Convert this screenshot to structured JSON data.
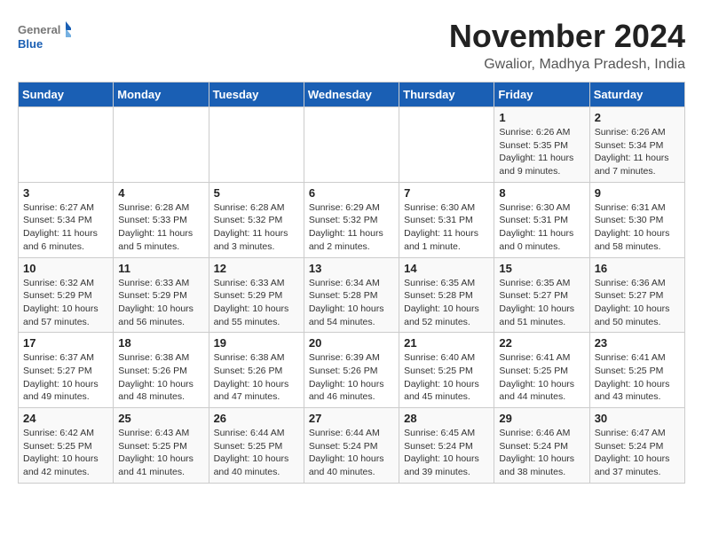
{
  "logo": {
    "general": "General",
    "blue": "Blue"
  },
  "title": "November 2024",
  "location": "Gwalior, Madhya Pradesh, India",
  "weekdays": [
    "Sunday",
    "Monday",
    "Tuesday",
    "Wednesday",
    "Thursday",
    "Friday",
    "Saturday"
  ],
  "weeks": [
    [
      {
        "day": "",
        "info": ""
      },
      {
        "day": "",
        "info": ""
      },
      {
        "day": "",
        "info": ""
      },
      {
        "day": "",
        "info": ""
      },
      {
        "day": "",
        "info": ""
      },
      {
        "day": "1",
        "info": "Sunrise: 6:26 AM\nSunset: 5:35 PM\nDaylight: 11 hours and 9 minutes."
      },
      {
        "day": "2",
        "info": "Sunrise: 6:26 AM\nSunset: 5:34 PM\nDaylight: 11 hours and 7 minutes."
      }
    ],
    [
      {
        "day": "3",
        "info": "Sunrise: 6:27 AM\nSunset: 5:34 PM\nDaylight: 11 hours and 6 minutes."
      },
      {
        "day": "4",
        "info": "Sunrise: 6:28 AM\nSunset: 5:33 PM\nDaylight: 11 hours and 5 minutes."
      },
      {
        "day": "5",
        "info": "Sunrise: 6:28 AM\nSunset: 5:32 PM\nDaylight: 11 hours and 3 minutes."
      },
      {
        "day": "6",
        "info": "Sunrise: 6:29 AM\nSunset: 5:32 PM\nDaylight: 11 hours and 2 minutes."
      },
      {
        "day": "7",
        "info": "Sunrise: 6:30 AM\nSunset: 5:31 PM\nDaylight: 11 hours and 1 minute."
      },
      {
        "day": "8",
        "info": "Sunrise: 6:30 AM\nSunset: 5:31 PM\nDaylight: 11 hours and 0 minutes."
      },
      {
        "day": "9",
        "info": "Sunrise: 6:31 AM\nSunset: 5:30 PM\nDaylight: 10 hours and 58 minutes."
      }
    ],
    [
      {
        "day": "10",
        "info": "Sunrise: 6:32 AM\nSunset: 5:29 PM\nDaylight: 10 hours and 57 minutes."
      },
      {
        "day": "11",
        "info": "Sunrise: 6:33 AM\nSunset: 5:29 PM\nDaylight: 10 hours and 56 minutes."
      },
      {
        "day": "12",
        "info": "Sunrise: 6:33 AM\nSunset: 5:29 PM\nDaylight: 10 hours and 55 minutes."
      },
      {
        "day": "13",
        "info": "Sunrise: 6:34 AM\nSunset: 5:28 PM\nDaylight: 10 hours and 54 minutes."
      },
      {
        "day": "14",
        "info": "Sunrise: 6:35 AM\nSunset: 5:28 PM\nDaylight: 10 hours and 52 minutes."
      },
      {
        "day": "15",
        "info": "Sunrise: 6:35 AM\nSunset: 5:27 PM\nDaylight: 10 hours and 51 minutes."
      },
      {
        "day": "16",
        "info": "Sunrise: 6:36 AM\nSunset: 5:27 PM\nDaylight: 10 hours and 50 minutes."
      }
    ],
    [
      {
        "day": "17",
        "info": "Sunrise: 6:37 AM\nSunset: 5:27 PM\nDaylight: 10 hours and 49 minutes."
      },
      {
        "day": "18",
        "info": "Sunrise: 6:38 AM\nSunset: 5:26 PM\nDaylight: 10 hours and 48 minutes."
      },
      {
        "day": "19",
        "info": "Sunrise: 6:38 AM\nSunset: 5:26 PM\nDaylight: 10 hours and 47 minutes."
      },
      {
        "day": "20",
        "info": "Sunrise: 6:39 AM\nSunset: 5:26 PM\nDaylight: 10 hours and 46 minutes."
      },
      {
        "day": "21",
        "info": "Sunrise: 6:40 AM\nSunset: 5:25 PM\nDaylight: 10 hours and 45 minutes."
      },
      {
        "day": "22",
        "info": "Sunrise: 6:41 AM\nSunset: 5:25 PM\nDaylight: 10 hours and 44 minutes."
      },
      {
        "day": "23",
        "info": "Sunrise: 6:41 AM\nSunset: 5:25 PM\nDaylight: 10 hours and 43 minutes."
      }
    ],
    [
      {
        "day": "24",
        "info": "Sunrise: 6:42 AM\nSunset: 5:25 PM\nDaylight: 10 hours and 42 minutes."
      },
      {
        "day": "25",
        "info": "Sunrise: 6:43 AM\nSunset: 5:25 PM\nDaylight: 10 hours and 41 minutes."
      },
      {
        "day": "26",
        "info": "Sunrise: 6:44 AM\nSunset: 5:25 PM\nDaylight: 10 hours and 40 minutes."
      },
      {
        "day": "27",
        "info": "Sunrise: 6:44 AM\nSunset: 5:24 PM\nDaylight: 10 hours and 40 minutes."
      },
      {
        "day": "28",
        "info": "Sunrise: 6:45 AM\nSunset: 5:24 PM\nDaylight: 10 hours and 39 minutes."
      },
      {
        "day": "29",
        "info": "Sunrise: 6:46 AM\nSunset: 5:24 PM\nDaylight: 10 hours and 38 minutes."
      },
      {
        "day": "30",
        "info": "Sunrise: 6:47 AM\nSunset: 5:24 PM\nDaylight: 10 hours and 37 minutes."
      }
    ]
  ]
}
